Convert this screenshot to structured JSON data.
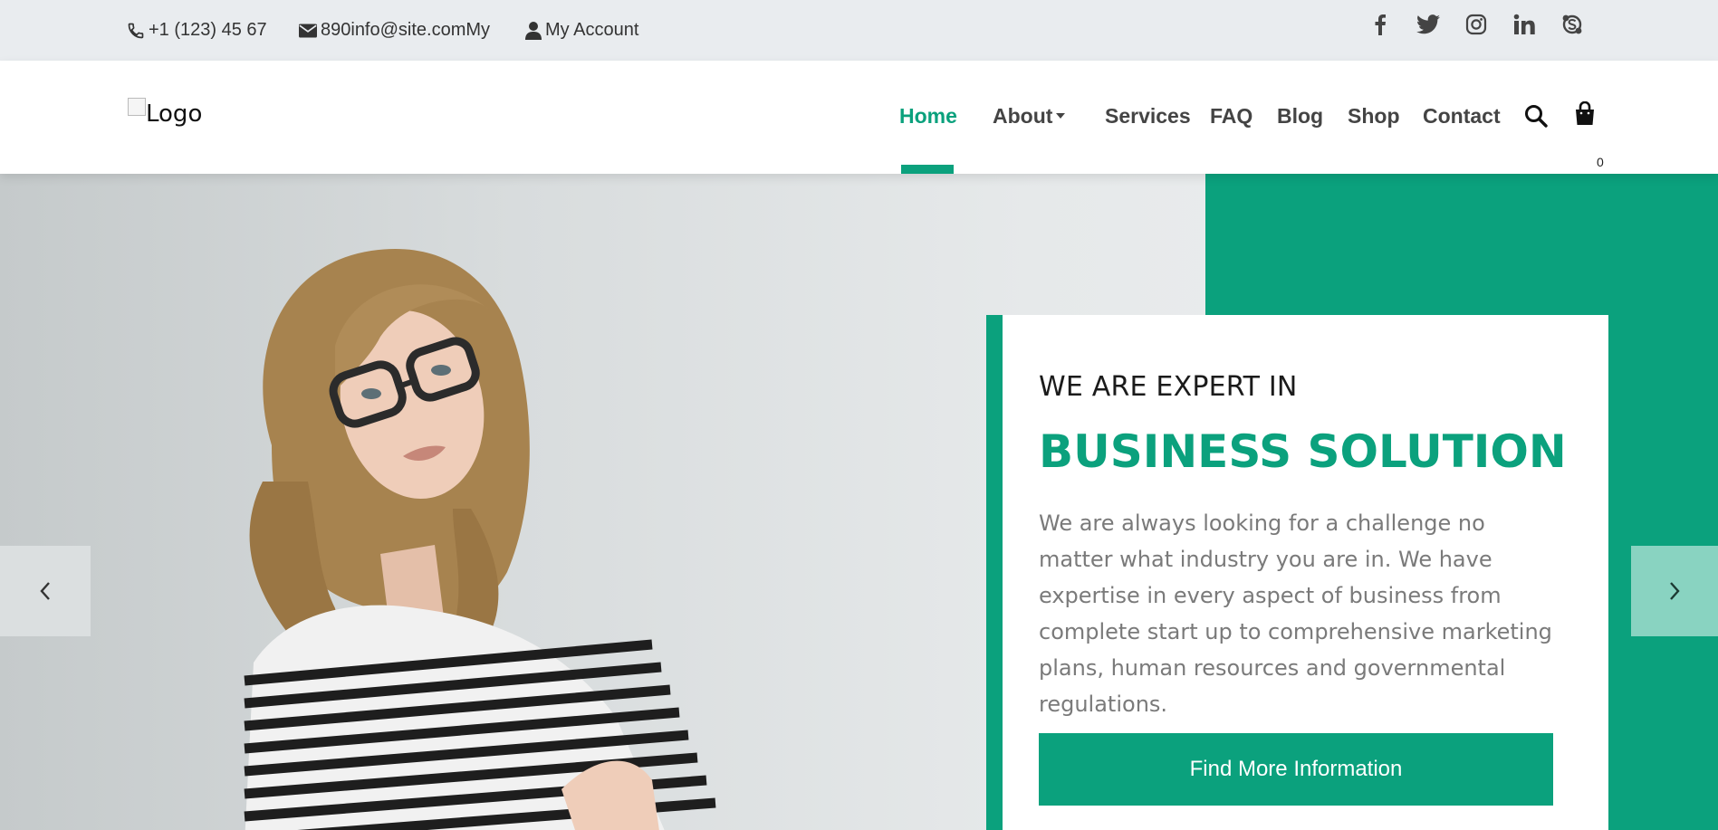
{
  "topbar": {
    "phone": "+1 (123) 45 67",
    "email": "890info@site.comMy",
    "account": "My Account",
    "social": [
      "facebook-icon",
      "twitter-icon",
      "instagram-icon",
      "linkedin-icon",
      "skype-icon"
    ]
  },
  "header": {
    "logo_alt": "Logo",
    "nav": {
      "home": "Home",
      "about": "About",
      "services": "Services",
      "faq": "FAQ",
      "blog": "Blog",
      "shop": "Shop",
      "contact": "Contact"
    },
    "active_item": "Home",
    "cart_count": "0"
  },
  "hero": {
    "kicker": "WE ARE EXPERT IN",
    "headline": "BUSINESS SOLUTION",
    "body": "We are always looking for a challenge no matter what industry you are in. We have expertise in every aspect of business from complete start up to comprehensive marketing plans, human resources and governmental regulations.",
    "cta": "Find More Information"
  },
  "colors": {
    "accent": "#0ba17d",
    "topbar_bg": "#e9ecef",
    "nav_text": "#444444",
    "body_text": "#7a7a7a"
  }
}
